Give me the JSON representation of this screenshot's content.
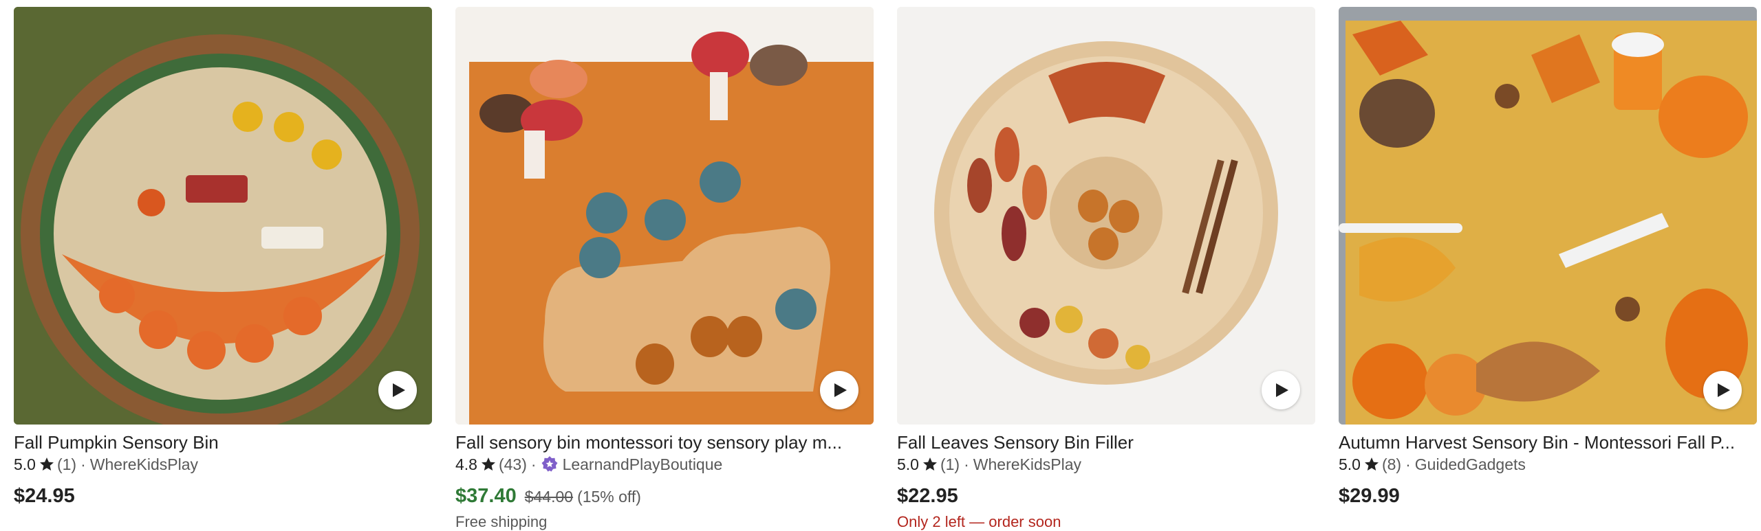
{
  "listings": [
    {
      "title": "Fall Pumpkin Sensory Bin",
      "rating": "5.0",
      "reviews": "(1)",
      "separator": "·",
      "shop": "WhereKidsPlay",
      "price": "$24.95"
    },
    {
      "title": "Fall sensory bin montessori toy sensory play m...",
      "rating": "4.8",
      "reviews": "(43)",
      "separator": "·",
      "shop": "LearnandPlayBoutique",
      "price": "$37.40",
      "original_price": "$44.00",
      "discount": "(15% off)",
      "shipping": "Free shipping"
    },
    {
      "title": "Fall Leaves Sensory Bin Filler",
      "rating": "5.0",
      "reviews": "(1)",
      "separator": "·",
      "shop": "WhereKidsPlay",
      "price": "$22.95",
      "stock_note": "Only 2 left — order soon"
    },
    {
      "title": "Autumn Harvest Sensory Bin - Montessori Fall P...",
      "rating": "5.0",
      "reviews": "(8)",
      "separator": "·",
      "shop": "GuidedGadgets",
      "price": "$29.99"
    }
  ],
  "icons": {
    "rating": "star-icon",
    "star_seller": "star-seller-badge-icon",
    "video": "play-icon"
  },
  "colors": {
    "sale_price": "#2f7a36",
    "stock_warning": "#b3261e",
    "star_seller_badge": "#7f5fc9"
  }
}
